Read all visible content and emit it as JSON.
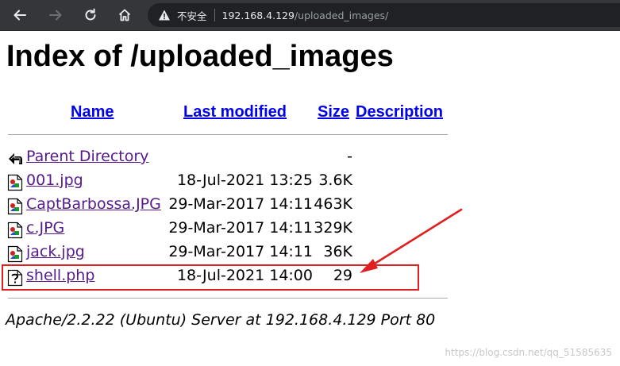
{
  "browser": {
    "security_label": "不安全",
    "url_host": "192.168.4.129",
    "url_path": "/uploaded_images/"
  },
  "page": {
    "title": "Index of /uploaded_images",
    "columns": {
      "name": "Name",
      "last_modified": "Last modified",
      "size": "Size",
      "description": "Description"
    },
    "entries": [
      {
        "name": "Parent Directory",
        "date": "",
        "size": "-",
        "icon": "back-icon"
      },
      {
        "name": "001.jpg",
        "date": "18-Jul-2021 13:25",
        "size": "3.6K",
        "icon": "image-file-icon"
      },
      {
        "name": "CaptBarbossa.JPG",
        "date": "29-Mar-2017 14:11",
        "size": "463K",
        "icon": "image-file-icon"
      },
      {
        "name": "c.JPG",
        "date": "29-Mar-2017 14:11",
        "size": "329K",
        "icon": "image-file-icon"
      },
      {
        "name": "jack.jpg",
        "date": "29-Mar-2017 14:11",
        "size": "36K",
        "icon": "image-file-icon"
      },
      {
        "name": "shell.php",
        "date": "18-Jul-2021 14:00",
        "size": "29",
        "icon": "unknown-file-icon"
      }
    ],
    "server_signature": "Apache/2.2.22 (Ubuntu) Server at 192.168.4.129 Port 80"
  },
  "annotation": {
    "highlight_color": "#e02020"
  },
  "watermark": "https://blog.csdn.net/qq_51585635"
}
